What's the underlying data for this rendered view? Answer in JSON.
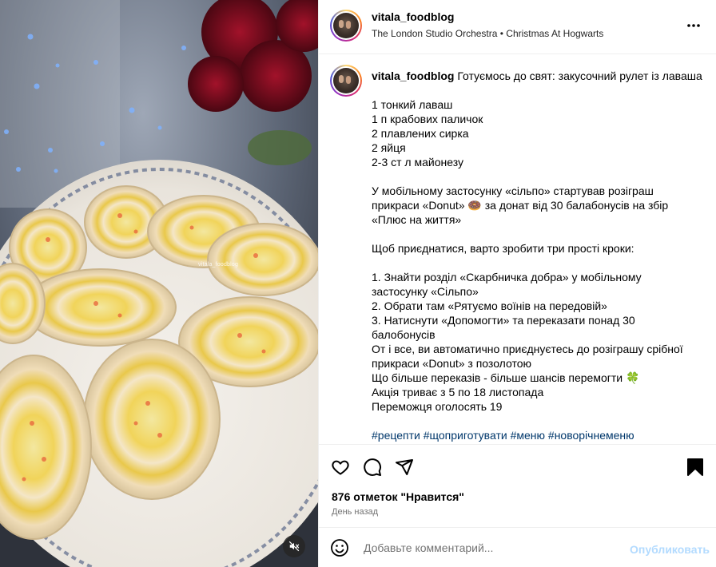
{
  "post": {
    "username": "vitala_foodblog",
    "audio": "The London Studio Orchestra • Christmas At Hogwarts",
    "more_icon": "more-horizontal-icon",
    "media_watermark": "vitala_foodblog"
  },
  "caption": {
    "username": "vitala_foodblog",
    "title": "Готуємось до свят: закусочний рулет із лаваша",
    "lines": [
      "",
      "1 тонкий лаваш",
      "1 п крабових паличок",
      "2 плавлених сирка",
      "2 яйця",
      "2-3 ст л майонезу",
      "",
      "У мобільному застосунку «сільпо» стартував розіграш",
      "прикраси «Donut» 🍩 за донат від 30 балабонусів на збір",
      "«Плюс на життя»",
      "",
      "Щоб приєднатися, варто зробити три прості кроки:",
      "",
      "1. Знайти розділ «Скарбничка добра» у мобільному",
      "застосунку «Сільпо»",
      "2. Обрати там «Рятуємо воїнів на передовій»",
      "3. Натиснути «Допомогти» та переказати понад 30",
      "балобонусів",
      "От і все, ви автоматично приєднуєтесь до розіграшу срібної",
      "прикраси «Donut» з позолотою",
      "Що більше переказів - більше шансів перемогти 🍀",
      "Акція триває з 5 по 18 листопада",
      "Переможця оголосять 19",
      ""
    ],
    "hashtags": [
      "#рецепти",
      "#щоприготувати",
      "#меню",
      "#новорічнеменю"
    ]
  },
  "actions": {
    "like_icon": "heart-icon",
    "comment_icon": "comment-icon",
    "share_icon": "share-icon",
    "save_icon": "bookmark-icon"
  },
  "likes_text": "876 отметок \"Нравится\"",
  "timestamp": "День назад",
  "comment": {
    "placeholder": "Добавьте комментарий...",
    "value": "",
    "publish_label": "Опубликовать"
  },
  "colors": {
    "link": "#00376b",
    "publish_disabled": "#b3dbff",
    "secondary_text": "#737373"
  }
}
